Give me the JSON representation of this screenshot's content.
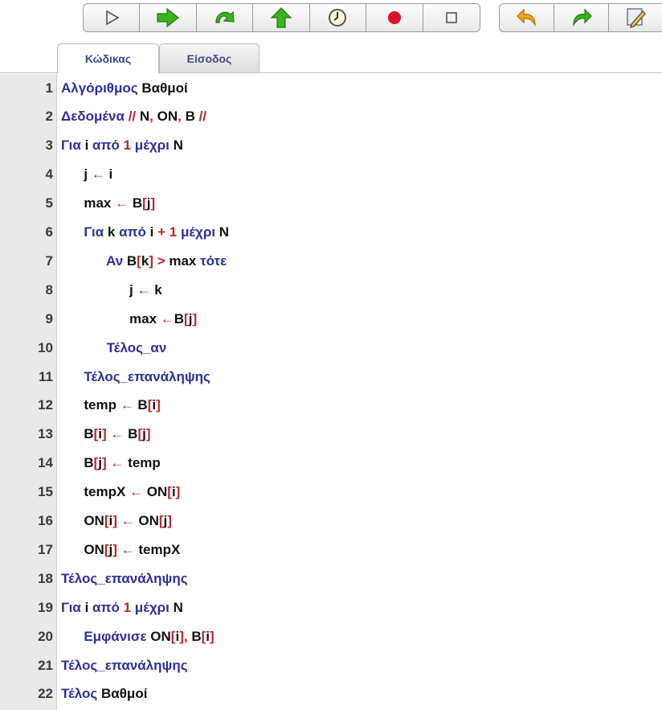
{
  "toolbar": {
    "run_group": [
      {
        "icon": "play-outline-icon"
      },
      {
        "icon": "step-forward-arrow-icon",
        "color": "#3bb31f"
      },
      {
        "icon": "redo-curve-icon",
        "color": "#3bb31f"
      },
      {
        "icon": "up-arrow-icon",
        "color": "#3bb31f"
      },
      {
        "icon": "timer-icon"
      },
      {
        "icon": "record-icon",
        "color": "#e0102a"
      },
      {
        "icon": "stop-square-icon"
      }
    ],
    "edit_group": [
      {
        "icon": "undo-icon",
        "color": "#f2a51c"
      },
      {
        "icon": "redo-icon",
        "color": "#3bb31f"
      },
      {
        "icon": "edit-pencil-icon"
      }
    ]
  },
  "tabs": [
    {
      "label": "Κώδικας",
      "active": true
    },
    {
      "label": "Είσοδος",
      "active": false
    }
  ],
  "colors": {
    "keyword": "#2e2f9c",
    "operator": "#c0242a",
    "identifier": "#111111",
    "gutter": "#e9e9e9"
  },
  "code_lines": [
    {
      "n": "1",
      "tokens": [
        [
          "Αλγόριθμος",
          "k"
        ],
        [
          " Βαθμοί",
          ""
        ]
      ]
    },
    {
      "n": "2",
      "tokens": [
        [
          "Δεδομένα ",
          "k"
        ],
        [
          "//",
          "r"
        ],
        [
          " N",
          ""
        ],
        [
          ",",
          "r"
        ],
        [
          " ON",
          ""
        ],
        [
          ",",
          "r"
        ],
        [
          " B ",
          ""
        ],
        [
          "//",
          "r"
        ]
      ]
    },
    {
      "n": "3",
      "tokens": [
        [
          "Για ",
          "k"
        ],
        [
          "i ",
          ""
        ],
        [
          "από ",
          "k"
        ],
        [
          "1 ",
          "r"
        ],
        [
          "μέχρι ",
          "k"
        ],
        [
          "N",
          ""
        ]
      ]
    },
    {
      "n": "4",
      "tokens": [
        [
          "      j ",
          ""
        ],
        [
          "← ",
          "r"
        ],
        [
          "i",
          ""
        ]
      ]
    },
    {
      "n": "5",
      "tokens": [
        [
          "      max ",
          ""
        ],
        [
          "← ",
          "r"
        ],
        [
          "B",
          ""
        ],
        [
          "[",
          "r"
        ],
        [
          "j",
          ""
        ],
        [
          "]",
          "r"
        ]
      ]
    },
    {
      "n": "6",
      "tokens": [
        [
          "      Για ",
          "k"
        ],
        [
          "k ",
          ""
        ],
        [
          "από ",
          "k"
        ],
        [
          "i ",
          ""
        ],
        [
          "+ 1 ",
          "r"
        ],
        [
          "μέχρι ",
          "k"
        ],
        [
          "N",
          ""
        ]
      ]
    },
    {
      "n": "7",
      "tokens": [
        [
          "            Αν ",
          "k"
        ],
        [
          "B",
          ""
        ],
        [
          "[",
          "r"
        ],
        [
          "k",
          ""
        ],
        [
          "]",
          "r"
        ],
        [
          " > ",
          "r"
        ],
        [
          "max ",
          ""
        ],
        [
          "τότε",
          "k"
        ]
      ]
    },
    {
      "n": "8",
      "tokens": [
        [
          "                  j ",
          ""
        ],
        [
          "← ",
          "r"
        ],
        [
          "k",
          ""
        ]
      ]
    },
    {
      "n": "9",
      "tokens": [
        [
          "                  max ",
          ""
        ],
        [
          "←",
          "r"
        ],
        [
          "B",
          ""
        ],
        [
          "[",
          "r"
        ],
        [
          "j",
          ""
        ],
        [
          "]",
          "r"
        ]
      ]
    },
    {
      "n": "10",
      "tokens": [
        [
          "            Τέλος_αν",
          "k"
        ]
      ]
    },
    {
      "n": "11",
      "tokens": [
        [
          "      Τέλος_επανάληψης",
          "k"
        ]
      ]
    },
    {
      "n": "12",
      "tokens": [
        [
          "      temp ",
          ""
        ],
        [
          "← ",
          "r"
        ],
        [
          "B",
          ""
        ],
        [
          "[",
          "r"
        ],
        [
          "i",
          ""
        ],
        [
          "]",
          "r"
        ]
      ]
    },
    {
      "n": "13",
      "tokens": [
        [
          "      B",
          ""
        ],
        [
          "[",
          "r"
        ],
        [
          "i",
          ""
        ],
        [
          "]",
          "r"
        ],
        [
          " ← ",
          "r"
        ],
        [
          "B",
          ""
        ],
        [
          "[",
          "r"
        ],
        [
          "j",
          ""
        ],
        [
          "]",
          "r"
        ]
      ]
    },
    {
      "n": "14",
      "tokens": [
        [
          "      B",
          ""
        ],
        [
          "[",
          "r"
        ],
        [
          "j",
          ""
        ],
        [
          "]",
          "r"
        ],
        [
          " ← ",
          "r"
        ],
        [
          "temp",
          ""
        ]
      ]
    },
    {
      "n": "15",
      "tokens": [
        [
          "      tempX ",
          ""
        ],
        [
          "← ",
          "r"
        ],
        [
          "ON",
          ""
        ],
        [
          "[",
          "r"
        ],
        [
          "i",
          ""
        ],
        [
          "]",
          "r"
        ]
      ]
    },
    {
      "n": "16",
      "tokens": [
        [
          "      ON",
          ""
        ],
        [
          "[",
          "r"
        ],
        [
          "i",
          ""
        ],
        [
          "]",
          "r"
        ],
        [
          " ← ",
          "r"
        ],
        [
          "ON",
          ""
        ],
        [
          "[",
          "r"
        ],
        [
          "j",
          ""
        ],
        [
          "]",
          "r"
        ]
      ]
    },
    {
      "n": "17",
      "tokens": [
        [
          "      ON",
          ""
        ],
        [
          "[",
          "r"
        ],
        [
          "j",
          ""
        ],
        [
          "]",
          "r"
        ],
        [
          " ← ",
          "r"
        ],
        [
          "tempX",
          ""
        ]
      ]
    },
    {
      "n": "18",
      "tokens": [
        [
          "Τέλος_επανάληψης",
          "k"
        ]
      ]
    },
    {
      "n": "19",
      "tokens": [
        [
          "Για ",
          "k"
        ],
        [
          "i ",
          ""
        ],
        [
          "από ",
          "k"
        ],
        [
          "1 ",
          "r"
        ],
        [
          "μέχρι ",
          "k"
        ],
        [
          "N",
          ""
        ]
      ]
    },
    {
      "n": "20",
      "tokens": [
        [
          "      Εμφάνισε ",
          "k"
        ],
        [
          "ON",
          ""
        ],
        [
          "[",
          "r"
        ],
        [
          "i",
          ""
        ],
        [
          "]",
          "r"
        ],
        [
          ", ",
          "r"
        ],
        [
          "B",
          ""
        ],
        [
          "[",
          "r"
        ],
        [
          "i",
          ""
        ],
        [
          "]",
          "r"
        ]
      ]
    },
    {
      "n": "21",
      "tokens": [
        [
          "Τέλος_επανάληψης",
          "k"
        ]
      ]
    },
    {
      "n": "22",
      "tokens": [
        [
          "Τέλος ",
          "k"
        ],
        [
          "Βαθμοί",
          ""
        ]
      ]
    }
  ]
}
